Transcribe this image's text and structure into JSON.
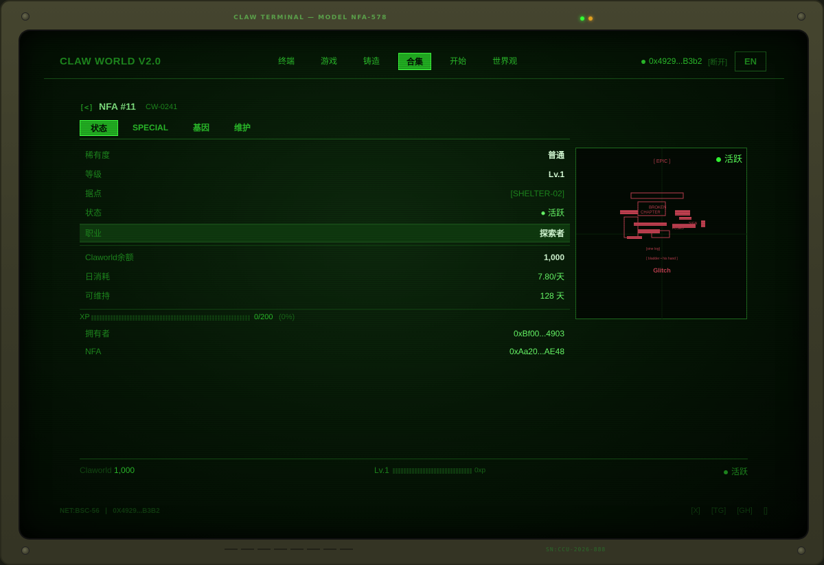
{
  "bezel": {
    "title": "CLAW TERMINAL — MODEL NFA-578",
    "serial": "SN:CCU-2026-888"
  },
  "header": {
    "brand": "CLAW WORLD V2.0",
    "nav": [
      {
        "label": "终端"
      },
      {
        "label": "游戏"
      },
      {
        "label": "铸造"
      },
      {
        "label": "合集",
        "active": true
      },
      {
        "label": "开始"
      },
      {
        "label": "世界观"
      }
    ],
    "wallet": "0x4929...B3b2",
    "disconnect": "[断开]",
    "lang": "EN"
  },
  "detail": {
    "back": "[<]",
    "title": "NFA #11",
    "code": "CW-0241",
    "tabs": [
      {
        "label": "状态",
        "active": true
      },
      {
        "label": "SPECIAL"
      },
      {
        "label": "基因"
      },
      {
        "label": "维护"
      }
    ],
    "rows": [
      {
        "key": "稀有度",
        "value": "普通"
      },
      {
        "key": "等级",
        "value": "Lv.1"
      },
      {
        "key": "据点",
        "value": "[SHELTER-02]"
      },
      {
        "key": "状态",
        "value": "● 活跃"
      },
      {
        "key": "职业",
        "value": "探索者"
      }
    ],
    "economy": [
      {
        "key": "Claworld余额",
        "value": "1,000"
      },
      {
        "key": "日消耗",
        "value": "7.80/天"
      },
      {
        "key": "可维持",
        "value": "128 天"
      }
    ],
    "xp": {
      "label": "XP",
      "value": "0/200",
      "pct": "(0%)",
      "fraction": 0
    },
    "owner": {
      "key": "拥有者",
      "value": "0xBf00...4903"
    },
    "nfa": {
      "key": "NFA",
      "value": "0xAa20...AE48"
    }
  },
  "card": {
    "status": "活跃",
    "rarity_tag": "[ EPIC ]",
    "art_text": [
      "BROKEN",
      "CHAPTER",
      "SIGN",
      "FUSED",
      "[sine log]",
      "[ bladder • his hand ]"
    ],
    "name": "Glitch"
  },
  "footer": {
    "claw_label": "Claworld",
    "claw_value": "1,000",
    "lv": "Lv.1",
    "xp_unit": "0xp",
    "status": "活跃"
  },
  "system": {
    "net": "NET:BSC-56",
    "sep": "|",
    "addr": "0X4929...B3B2",
    "links": [
      "[X]",
      "[TG]",
      "[GH]",
      "[]"
    ]
  },
  "colors": {
    "accent": "#22b022",
    "text": "#2bbf2b",
    "bright": "#5aff5a",
    "art": "#c04050"
  }
}
